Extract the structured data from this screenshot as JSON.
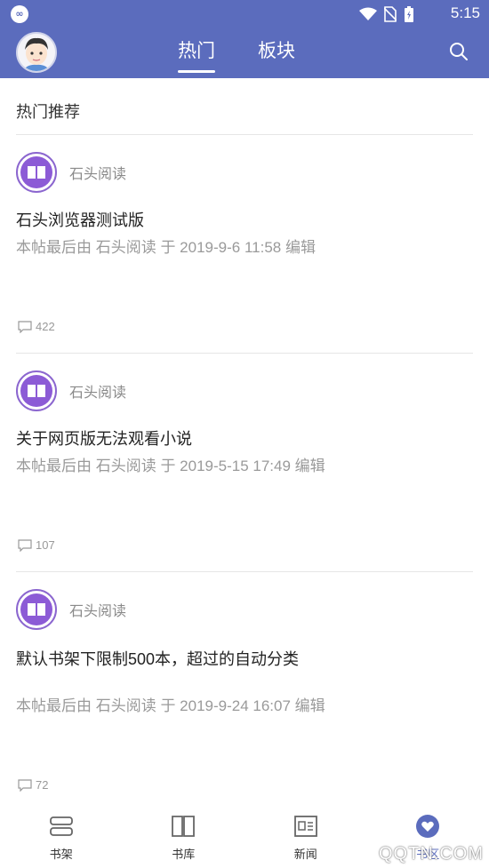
{
  "status_bar": {
    "time": "5:15",
    "app_glyph": "∞"
  },
  "header": {
    "tabs": [
      {
        "label": "热门",
        "active": true
      },
      {
        "label": "板块",
        "active": false
      }
    ],
    "accent_color": "#5b6cbd"
  },
  "section": {
    "title": "热门推荐"
  },
  "posts": [
    {
      "author": "石头阅读",
      "title": "石头浏览器测试版",
      "meta": "本帖最后由 石头阅读 于 2019-9-6 11:58 编辑",
      "comments": "422"
    },
    {
      "author": "石头阅读",
      "title": "关于网页版无法观看小说",
      "meta": "本帖最后由 石头阅读 于 2019-5-15 17:49 编辑",
      "comments": "107"
    },
    {
      "author": "石头阅读",
      "title": "默认书架下限制500本，超过的自动分类",
      "meta": "本帖最后由 石头阅读 于 2019-9-24 16:07 编辑",
      "comments": "72"
    }
  ],
  "bottom_nav": [
    {
      "label": "书架",
      "icon": "bookshelf-icon"
    },
    {
      "label": "书库",
      "icon": "book-library-icon"
    },
    {
      "label": "新闻",
      "icon": "newspaper-icon"
    },
    {
      "label": "书区",
      "icon": "community-heart-icon",
      "active": true
    }
  ],
  "watermark": "QQTN.COM"
}
